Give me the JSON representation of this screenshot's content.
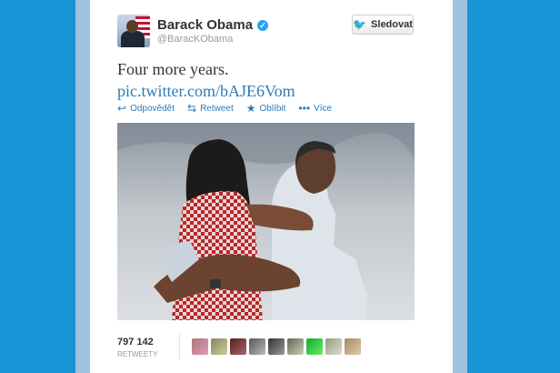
{
  "tweet": {
    "author_name": "Barack Obama",
    "author_handle": "@BaracKObama",
    "text": "Four more years.",
    "link": "pic.twitter.com/bAJE6Vom"
  },
  "follow_button": {
    "label": "Sledovat"
  },
  "actions": {
    "reply": "Odpovědět",
    "retweet": "Retweet",
    "favorite": "Oblíbit",
    "more": "Více"
  },
  "stats": {
    "retweet_count": "797 142",
    "retweet_label": "RETWEETY"
  },
  "icons": {
    "verified": "verified-badge-icon",
    "follow": "twitter-bird-icon",
    "reply": "reply-arrow-icon",
    "retweet": "retweet-icon",
    "favorite": "star-icon",
    "more": "more-dots-icon"
  },
  "colors": {
    "background": "#1895d6",
    "link": "#2b7bb9",
    "verified": "#2aa3ef"
  }
}
